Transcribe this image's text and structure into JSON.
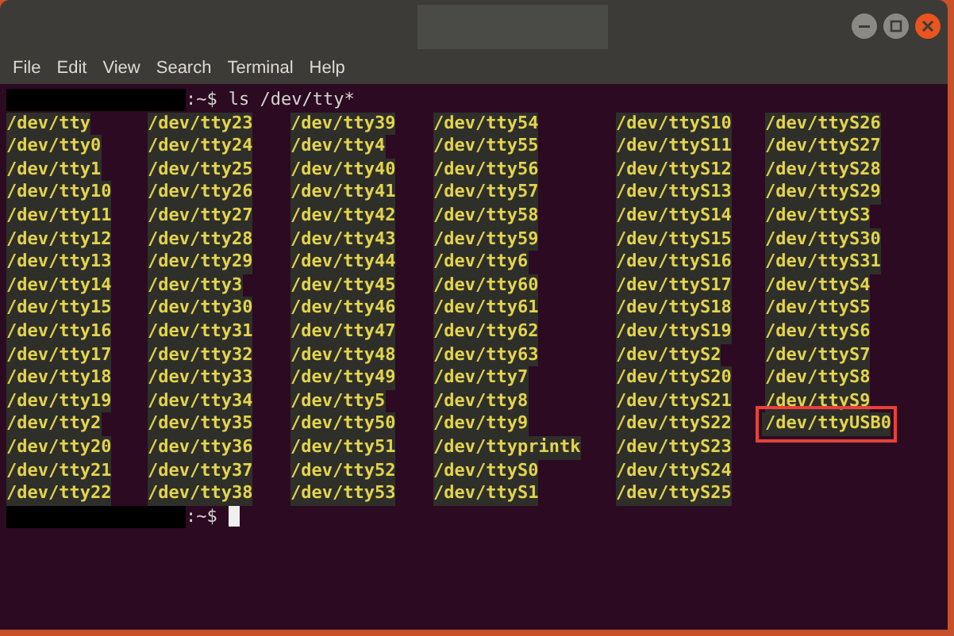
{
  "menu": [
    "File",
    "Edit",
    "View",
    "Search",
    "Terminal",
    "Help"
  ],
  "command_prompt": {
    "prompt": ":~$",
    "command": "ls /dev/tty*"
  },
  "listing": [
    [
      {
        "name": "/dev/tty",
        "highlighted": false
      },
      {
        "name": "/dev/tty0",
        "highlighted": false
      },
      {
        "name": "/dev/tty1",
        "highlighted": false
      },
      {
        "name": "/dev/tty10",
        "highlighted": false
      },
      {
        "name": "/dev/tty11",
        "highlighted": false
      },
      {
        "name": "/dev/tty12",
        "highlighted": false
      },
      {
        "name": "/dev/tty13",
        "highlighted": false
      },
      {
        "name": "/dev/tty14",
        "highlighted": false
      },
      {
        "name": "/dev/tty15",
        "highlighted": false
      },
      {
        "name": "/dev/tty16",
        "highlighted": false
      },
      {
        "name": "/dev/tty17",
        "highlighted": false
      },
      {
        "name": "/dev/tty18",
        "highlighted": false
      },
      {
        "name": "/dev/tty19",
        "highlighted": false
      },
      {
        "name": "/dev/tty2",
        "highlighted": false
      },
      {
        "name": "/dev/tty20",
        "highlighted": false
      },
      {
        "name": "/dev/tty21",
        "highlighted": false
      },
      {
        "name": "/dev/tty22",
        "highlighted": false
      }
    ],
    [
      {
        "name": "/dev/tty23",
        "highlighted": false
      },
      {
        "name": "/dev/tty24",
        "highlighted": false
      },
      {
        "name": "/dev/tty25",
        "highlighted": false
      },
      {
        "name": "/dev/tty26",
        "highlighted": false
      },
      {
        "name": "/dev/tty27",
        "highlighted": false
      },
      {
        "name": "/dev/tty28",
        "highlighted": false
      },
      {
        "name": "/dev/tty29",
        "highlighted": false
      },
      {
        "name": "/dev/tty3",
        "highlighted": false
      },
      {
        "name": "/dev/tty30",
        "highlighted": false
      },
      {
        "name": "/dev/tty31",
        "highlighted": false
      },
      {
        "name": "/dev/tty32",
        "highlighted": false
      },
      {
        "name": "/dev/tty33",
        "highlighted": false
      },
      {
        "name": "/dev/tty34",
        "highlighted": false
      },
      {
        "name": "/dev/tty35",
        "highlighted": false
      },
      {
        "name": "/dev/tty36",
        "highlighted": false
      },
      {
        "name": "/dev/tty37",
        "highlighted": false
      },
      {
        "name": "/dev/tty38",
        "highlighted": false
      }
    ],
    [
      {
        "name": "/dev/tty39",
        "highlighted": false
      },
      {
        "name": "/dev/tty4",
        "highlighted": false
      },
      {
        "name": "/dev/tty40",
        "highlighted": false
      },
      {
        "name": "/dev/tty41",
        "highlighted": false
      },
      {
        "name": "/dev/tty42",
        "highlighted": false
      },
      {
        "name": "/dev/tty43",
        "highlighted": false
      },
      {
        "name": "/dev/tty44",
        "highlighted": false
      },
      {
        "name": "/dev/tty45",
        "highlighted": false
      },
      {
        "name": "/dev/tty46",
        "highlighted": false
      },
      {
        "name": "/dev/tty47",
        "highlighted": false
      },
      {
        "name": "/dev/tty48",
        "highlighted": false
      },
      {
        "name": "/dev/tty49",
        "highlighted": false
      },
      {
        "name": "/dev/tty5",
        "highlighted": false
      },
      {
        "name": "/dev/tty50",
        "highlighted": false
      },
      {
        "name": "/dev/tty51",
        "highlighted": false
      },
      {
        "name": "/dev/tty52",
        "highlighted": false
      },
      {
        "name": "/dev/tty53",
        "highlighted": false
      }
    ],
    [
      {
        "name": "/dev/tty54",
        "highlighted": false
      },
      {
        "name": "/dev/tty55",
        "highlighted": false
      },
      {
        "name": "/dev/tty56",
        "highlighted": false
      },
      {
        "name": "/dev/tty57",
        "highlighted": false
      },
      {
        "name": "/dev/tty58",
        "highlighted": false
      },
      {
        "name": "/dev/tty59",
        "highlighted": false
      },
      {
        "name": "/dev/tty6",
        "highlighted": false
      },
      {
        "name": "/dev/tty60",
        "highlighted": false
      },
      {
        "name": "/dev/tty61",
        "highlighted": false
      },
      {
        "name": "/dev/tty62",
        "highlighted": false
      },
      {
        "name": "/dev/tty63",
        "highlighted": false
      },
      {
        "name": "/dev/tty7",
        "highlighted": false
      },
      {
        "name": "/dev/tty8",
        "highlighted": false
      },
      {
        "name": "/dev/tty9",
        "highlighted": false
      },
      {
        "name": "/dev/ttyprintk",
        "highlighted": false
      },
      {
        "name": "/dev/ttyS0",
        "highlighted": false
      },
      {
        "name": "/dev/ttyS1",
        "highlighted": false
      }
    ],
    [
      {
        "name": "/dev/ttyS10",
        "highlighted": false
      },
      {
        "name": "/dev/ttyS11",
        "highlighted": false
      },
      {
        "name": "/dev/ttyS12",
        "highlighted": false
      },
      {
        "name": "/dev/ttyS13",
        "highlighted": false
      },
      {
        "name": "/dev/ttyS14",
        "highlighted": false
      },
      {
        "name": "/dev/ttyS15",
        "highlighted": false
      },
      {
        "name": "/dev/ttyS16",
        "highlighted": false
      },
      {
        "name": "/dev/ttyS17",
        "highlighted": false
      },
      {
        "name": "/dev/ttyS18",
        "highlighted": false
      },
      {
        "name": "/dev/ttyS19",
        "highlighted": false
      },
      {
        "name": "/dev/ttyS2",
        "highlighted": false
      },
      {
        "name": "/dev/ttyS20",
        "highlighted": false
      },
      {
        "name": "/dev/ttyS21",
        "highlighted": false
      },
      {
        "name": "/dev/ttyS22",
        "highlighted": false
      },
      {
        "name": "/dev/ttyS23",
        "highlighted": false
      },
      {
        "name": "/dev/ttyS24",
        "highlighted": false
      },
      {
        "name": "/dev/ttyS25",
        "highlighted": false
      }
    ],
    [
      {
        "name": "/dev/ttyS26",
        "highlighted": false
      },
      {
        "name": "/dev/ttyS27",
        "highlighted": false
      },
      {
        "name": "/dev/ttyS28",
        "highlighted": false
      },
      {
        "name": "/dev/ttyS29",
        "highlighted": false
      },
      {
        "name": "/dev/ttyS3",
        "highlighted": false
      },
      {
        "name": "/dev/ttyS30",
        "highlighted": false
      },
      {
        "name": "/dev/ttyS31",
        "highlighted": false
      },
      {
        "name": "/dev/ttyS4",
        "highlighted": false
      },
      {
        "name": "/dev/ttyS5",
        "highlighted": false
      },
      {
        "name": "/dev/ttyS6",
        "highlighted": false
      },
      {
        "name": "/dev/ttyS7",
        "highlighted": false
      },
      {
        "name": "/dev/ttyS8",
        "highlighted": false
      },
      {
        "name": "/dev/ttyS9",
        "highlighted": false
      },
      {
        "name": "/dev/ttyUSB0",
        "highlighted": true
      }
    ]
  ],
  "final_prompt": {
    "prompt": ":~$"
  }
}
